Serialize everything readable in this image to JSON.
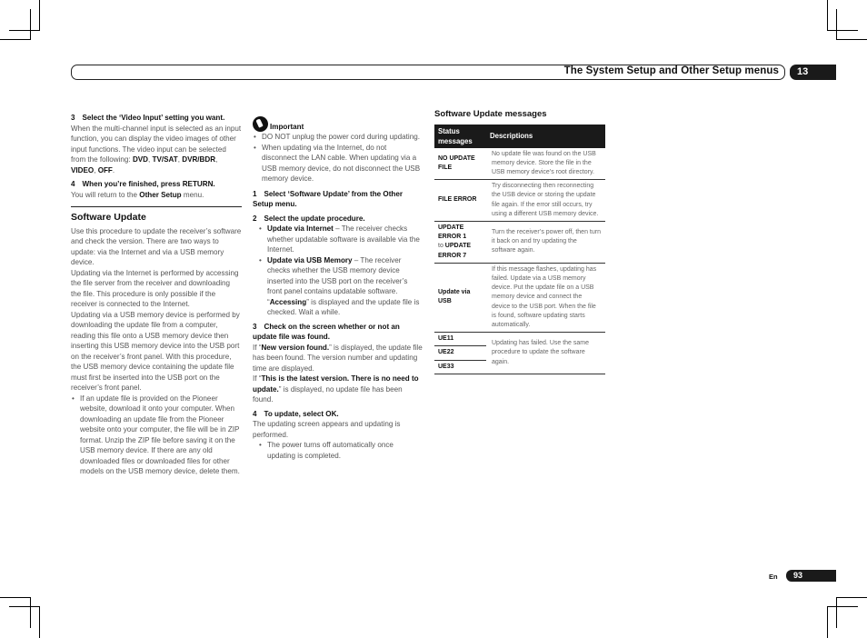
{
  "header": {
    "title": "The System Setup and Other Setup menus",
    "chapter": "13"
  },
  "footer": {
    "lang": "En",
    "page": "93"
  },
  "col1": {
    "step3_num": "3",
    "step3_title": "Select the ‘Video Input’ setting you want.",
    "step3_text": "When the multi-channel input is selected as an input function, you can display the video images of other input functions. The video input can be selected from the following: ",
    "step3_options": [
      "DVD",
      "TV/SAT",
      "DVR/BDR",
      "VIDEO",
      "OFF"
    ],
    "step4_num": "4",
    "step4_title": "When you’re finished, press RETURN.",
    "step4_text_pre": "You will return to the ",
    "step4_text_bold": "Other Setup",
    "step4_text_post": " menu.",
    "section_title": "Software Update",
    "para1": "Use this procedure to update the receiver’s software and check the version. There are two ways to update: via the Internet and via a USB memory device.",
    "para2": "Updating via the Internet is performed by accessing the file server from the receiver and downloading the file. This procedure is only possible if the receiver is connected to the Internet.",
    "para3": "Updating via a USB memory device is performed by downloading the update file from a computer, reading this file onto a USB memory device then inserting this USB memory device into the USB port on the receiver’s front panel. With this procedure, the USB memory device containing the update file must first be inserted into the USB port on the receiver’s front panel.",
    "bullet1": "If an update file is provided on the Pioneer website, download it onto your computer. When downloading an update file from the Pioneer website onto your computer, the file will be in ZIP format. Unzip the ZIP file before saving it on the USB memory device. If there are any old downloaded files or downloaded files for other models on the USB memory device, delete them."
  },
  "col2": {
    "important_label": "Important",
    "important_bullets": [
      "DO NOT unplug the power cord during updating.",
      "When updating via the Internet, do not disconnect the LAN cable. When updating via a USB memory device, do not disconnect the USB memory device."
    ],
    "step1_num": "1",
    "step1_title": "Select ‘Software Update’ from the Other Setup menu.",
    "step2_num": "2",
    "step2_title": "Select the update procedure.",
    "step2_b1_bold": "Update via Internet",
    "step2_b1_text": " – The receiver checks whether updatable software is available via the Internet.",
    "step2_b2_bold": "Update via USB Memory",
    "step2_b2_text": " – The receiver checks whether the USB memory device inserted into the USB port on the receiver’s front panel contains updatable software. “",
    "step2_b2_bold2": "Accessing",
    "step2_b2_text2": "” is displayed and the update file is checked. Wait a while.",
    "step3_num": "3",
    "step3_title": "Check on the screen whether or not an update file was found.",
    "step3_p1_pre": "If “",
    "step3_p1_bold": "New version found.",
    "step3_p1_post": "” is displayed, the update file has been found. The version number and updating time are displayed.",
    "step3_p2_pre": "If “",
    "step3_p2_bold": "This is the latest version. There is no need to update.",
    "step3_p2_post": "” is displayed, no update file has been found.",
    "step4_num": "4",
    "step4_title": "To update, select OK.",
    "step4_text": "The updating screen appears and updating is performed.",
    "step4_bullet": "The power turns off automatically once updating is completed."
  },
  "table": {
    "title": "Software Update messages",
    "headers": [
      "Status messages",
      "Descriptions"
    ],
    "rows": [
      {
        "status": "NO UPDATE FILE",
        "desc": "No update file was found on the USB memory device. Store the file in the USB memory device’s root directory."
      },
      {
        "status": "FILE ERROR",
        "desc": "Try disconnecting then reconnecting the USB device or storing the update file again. If the error still occurs, try using a different USB memory device."
      },
      {
        "status_a": "UPDATE ERROR 1",
        "status_to": "to",
        "status_b": "UPDATE ERROR 7",
        "desc": "Turn the receiver’s power off, then turn it back on and try updating the software again."
      },
      {
        "status": "Update via USB",
        "desc": "If this message flashes, updating has failed. Update via a USB memory device. Put the update file on a USB memory device and connect the device to the USB port. When the file is found, software updating starts automatically."
      },
      {
        "status": "UE11",
        "desc": "Updating has failed. Use the same procedure to update the software again."
      },
      {
        "status": "UE22"
      },
      {
        "status": "UE33"
      }
    ]
  }
}
